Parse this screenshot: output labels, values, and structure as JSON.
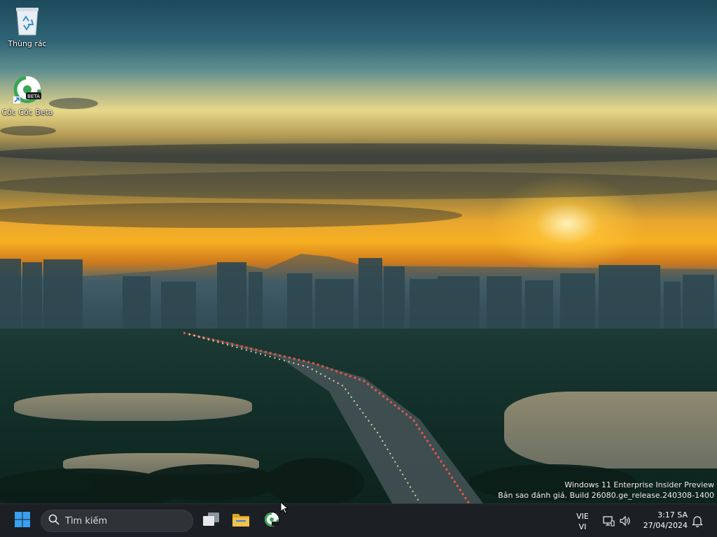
{
  "desktop": {
    "icons": [
      {
        "label": "Thùng rác",
        "icon": "recycle-bin-icon"
      },
      {
        "label": "Cốc Cốc Beta",
        "icon": "coccoc-beta-icon"
      }
    ],
    "watermark": {
      "line1": "Windows 11 Enterprise Insider Preview",
      "line2": "Bản sao đánh giá. Build 26080.ge_release.240308-1400"
    }
  },
  "taskbar": {
    "start_icon": "windows-start-icon",
    "search": {
      "placeholder": "Tìm kiếm",
      "icon": "search-icon"
    },
    "apps": [
      {
        "name": "task-view",
        "icon": "task-view-icon"
      },
      {
        "name": "file-explorer",
        "icon": "folder-icon"
      },
      {
        "name": "coccoc-beta",
        "icon": "coccoc-beta-icon"
      }
    ],
    "tray": {
      "lang_top": "VIE",
      "lang_bottom": "VI",
      "time": "3:17 SA",
      "date": "27/04/2024"
    }
  },
  "colors": {
    "taskbar_bg": "#1c2024",
    "win_blue": "#3aa0f0",
    "folder_yellow": "#f2c14e",
    "coccoc_green": "#3aa657"
  }
}
